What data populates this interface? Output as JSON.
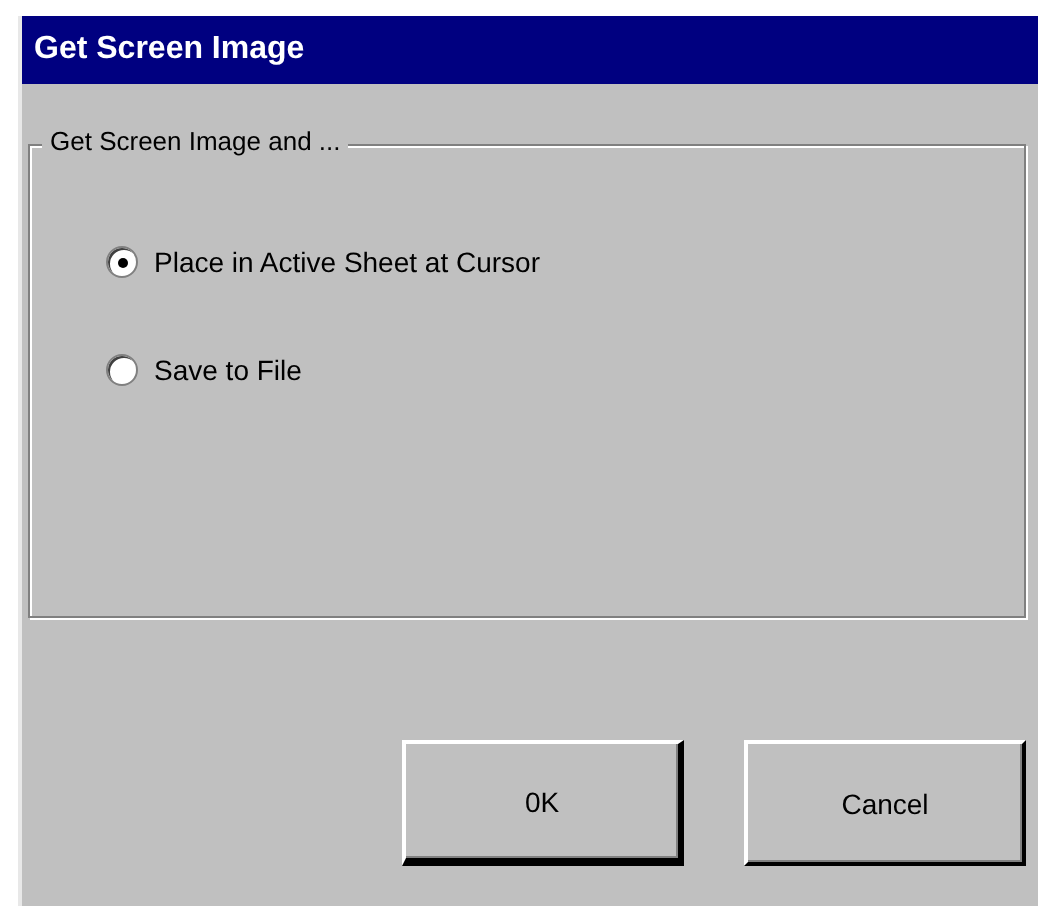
{
  "window": {
    "title": "Get Screen Image"
  },
  "group": {
    "label": "Get Screen Image and ...",
    "options": [
      {
        "label": "Place in Active Sheet at Cursor",
        "selected": true
      },
      {
        "label": "Save to File",
        "selected": false
      }
    ]
  },
  "buttons": [
    {
      "label": "0K",
      "default": true
    },
    {
      "label": "Cancel",
      "default": false
    }
  ]
}
